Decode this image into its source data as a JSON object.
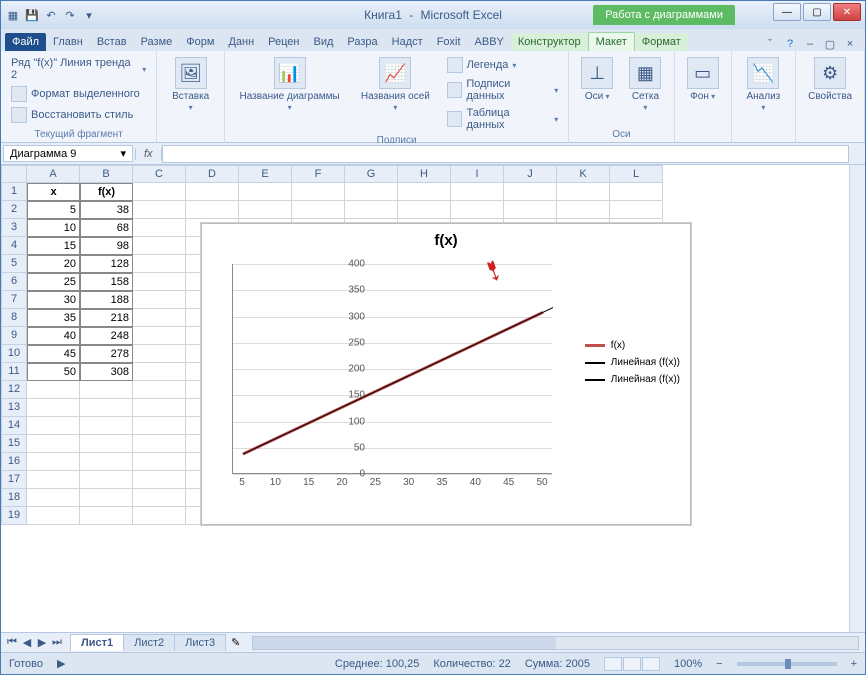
{
  "window": {
    "doc_title": "Книга1",
    "app_title": "Microsoft Excel",
    "chart_tools": "Работа с диаграммами"
  },
  "tabs": {
    "file": "Файл",
    "list": [
      "Главн",
      "Встав",
      "Разме",
      "Форм",
      "Данн",
      "Рецен",
      "Вид",
      "Разра",
      "Надст",
      "Foxit",
      "ABBY"
    ],
    "chart_tabs": [
      "Конструктор",
      "Макет",
      "Формат"
    ],
    "active_chart_tab": 1
  },
  "ribbon": {
    "selection_dropdown": "Ряд \"f(x)\" Линия тренда 2",
    "format_selection": "Формат выделенного",
    "reset_style": "Восстановить стиль",
    "group1": "Текущий фрагмент",
    "insert": "Вставка",
    "chart_title": "Название диаграммы",
    "axis_titles": "Названия осей",
    "legend": "Легенда",
    "data_labels": "Подписи данных",
    "data_table": "Таблица данных",
    "group_labels": "Подписи",
    "axes": "Оси",
    "gridlines": "Сетка",
    "group_axes": "Оси",
    "background": "Фон",
    "analysis": "Анализ",
    "properties": "Свойства"
  },
  "namebox": "Диаграмма 9",
  "sheet": {
    "cols": [
      "A",
      "B",
      "C",
      "D",
      "E",
      "F",
      "G",
      "H",
      "I",
      "J",
      "K",
      "L"
    ],
    "header": {
      "a": "x",
      "b": "f(x)"
    },
    "data": [
      {
        "x": "5",
        "fx": "38"
      },
      {
        "x": "10",
        "fx": "68"
      },
      {
        "x": "15",
        "fx": "98"
      },
      {
        "x": "20",
        "fx": "128"
      },
      {
        "x": "25",
        "fx": "158"
      },
      {
        "x": "30",
        "fx": "188"
      },
      {
        "x": "35",
        "fx": "218"
      },
      {
        "x": "40",
        "fx": "248"
      },
      {
        "x": "45",
        "fx": "278"
      },
      {
        "x": "50",
        "fx": "308"
      }
    ],
    "extra_rows": 8
  },
  "chart_data": {
    "type": "line",
    "title": "f(x)",
    "x": [
      5,
      10,
      15,
      20,
      25,
      30,
      35,
      40,
      45,
      50
    ],
    "series": [
      {
        "name": "f(x)",
        "values": [
          38,
          68,
          98,
          128,
          158,
          188,
          218,
          248,
          278,
          308
        ],
        "color": "#c0504d"
      },
      {
        "name": "Линейная (f(x))",
        "values": [
          38,
          68,
          98,
          128,
          158,
          188,
          218,
          248,
          278,
          308
        ],
        "color": "#000000",
        "trendline": true,
        "forecast_end": {
          "x": 55,
          "y": 338
        }
      },
      {
        "name": "Линейная (f(x))",
        "values": [
          38,
          68,
          98,
          128,
          158,
          188,
          218,
          248,
          278,
          308
        ],
        "color": "#000000",
        "trendline": true
      }
    ],
    "yticks": [
      0,
      50,
      100,
      150,
      200,
      250,
      300,
      350,
      400
    ],
    "xticks": [
      5,
      10,
      15,
      20,
      25,
      30,
      35,
      40,
      45,
      50
    ],
    "ylim": [
      0,
      400
    ],
    "legend": [
      "f(x)",
      "Линейная (f(x))",
      "Линейная (f(x))"
    ]
  },
  "sheet_tabs": [
    "Лист1",
    "Лист2",
    "Лист3"
  ],
  "status": {
    "ready": "Готово",
    "avg_label": "Среднее:",
    "avg": "100,25",
    "count_label": "Количество:",
    "count": "22",
    "sum_label": "Сумма:",
    "sum": "2005",
    "zoom": "100%"
  }
}
